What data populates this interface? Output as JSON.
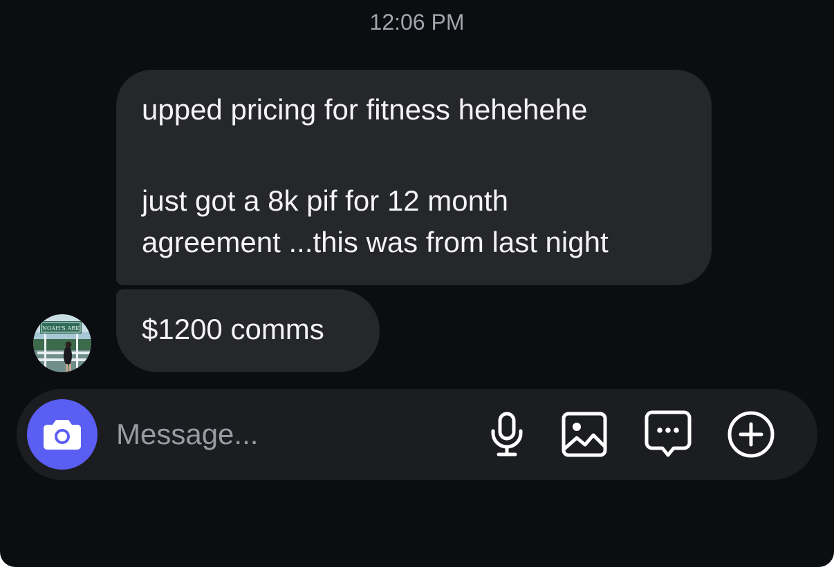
{
  "thread": {
    "timestamp": "12:06 PM",
    "messages": [
      {
        "lines": [
          "upped pricing for fitness hehehehe",
          "just got a 8k pif for 12 month",
          "agreement ...this was from last night"
        ]
      },
      {
        "text": "$1200 comms"
      }
    ],
    "sender_avatar_sign_text": "NOAH'S ARK"
  },
  "composer": {
    "placeholder": "Message...",
    "value": "",
    "icons": {
      "camera": "camera-icon",
      "mic": "microphone-icon",
      "gallery": "image-icon",
      "sticker": "chat-bubble-dots-icon",
      "add": "plus-circle-icon"
    }
  },
  "colors": {
    "background": "#0c0d11",
    "bubble": "#26272b",
    "composer": "#1c1d21",
    "accent": "#5a5ef2",
    "timestamp": "#a2a5ac",
    "text": "#f4f4f6"
  }
}
